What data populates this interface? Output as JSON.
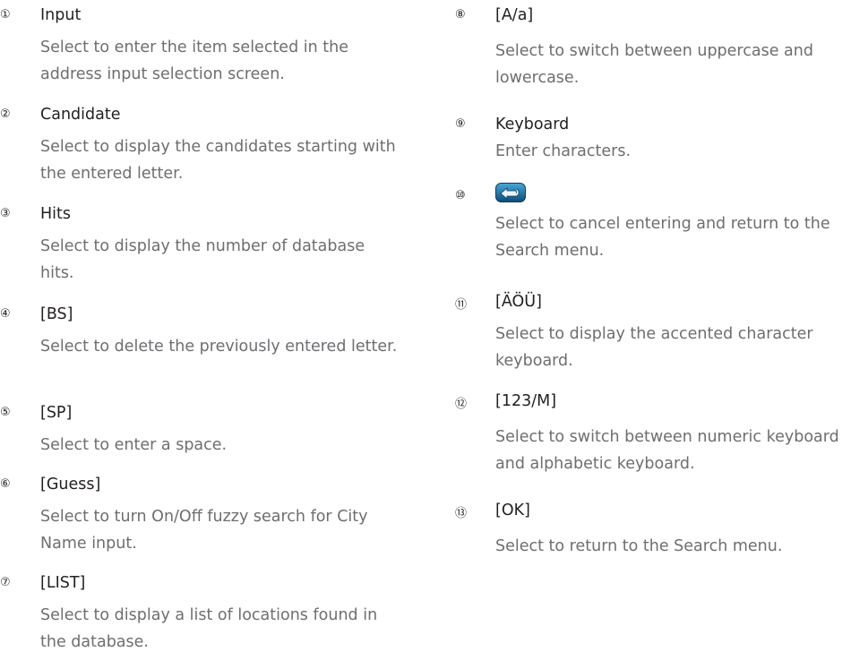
{
  "left_items": [
    {
      "num": "①",
      "term": "Input",
      "desc": "Select to enter the item selected in the address input selection screen."
    },
    {
      "num": "②",
      "term": "Candidate",
      "desc": "Select to display the candidates starting with the entered letter."
    },
    {
      "num": "③",
      "term": "Hits",
      "desc": "Select to display the number of database hits."
    },
    {
      "num": "④",
      "term": "[BS]",
      "desc": "Select to delete the previously entered letter."
    },
    {
      "num": "⑤",
      "term": "[SP]",
      "desc": "Select to enter a space."
    },
    {
      "num": "⑥",
      "term": "[Guess]",
      "desc": "Select to turn On/Off fuzzy search for City Name input."
    },
    {
      "num": "⑦",
      "term": "[LIST]",
      "desc": "Select to display a list of locations found in the database."
    }
  ],
  "right_items": [
    {
      "num": "⑧",
      "term": "[A/a]",
      "desc": "Select to switch between uppercase and lowercase."
    },
    {
      "num": "⑨",
      "term": "Keyboard",
      "desc": "Enter characters."
    },
    {
      "num": "⑩",
      "term": "",
      "icon": "return-arrow-icon",
      "desc": "Select to cancel entering and return to the Search menu."
    },
    {
      "num": "⑪",
      "term": "[ÄÖÜ]",
      "desc": "Select to display the accented character keyboard."
    },
    {
      "num": "⑫",
      "term": "[123/M]",
      "desc": "Select to switch between numeric keyboard and alphabetic keyboard."
    },
    {
      "num": "⑬",
      "term": "[OK]",
      "desc": "Select to return to the Search menu."
    }
  ]
}
